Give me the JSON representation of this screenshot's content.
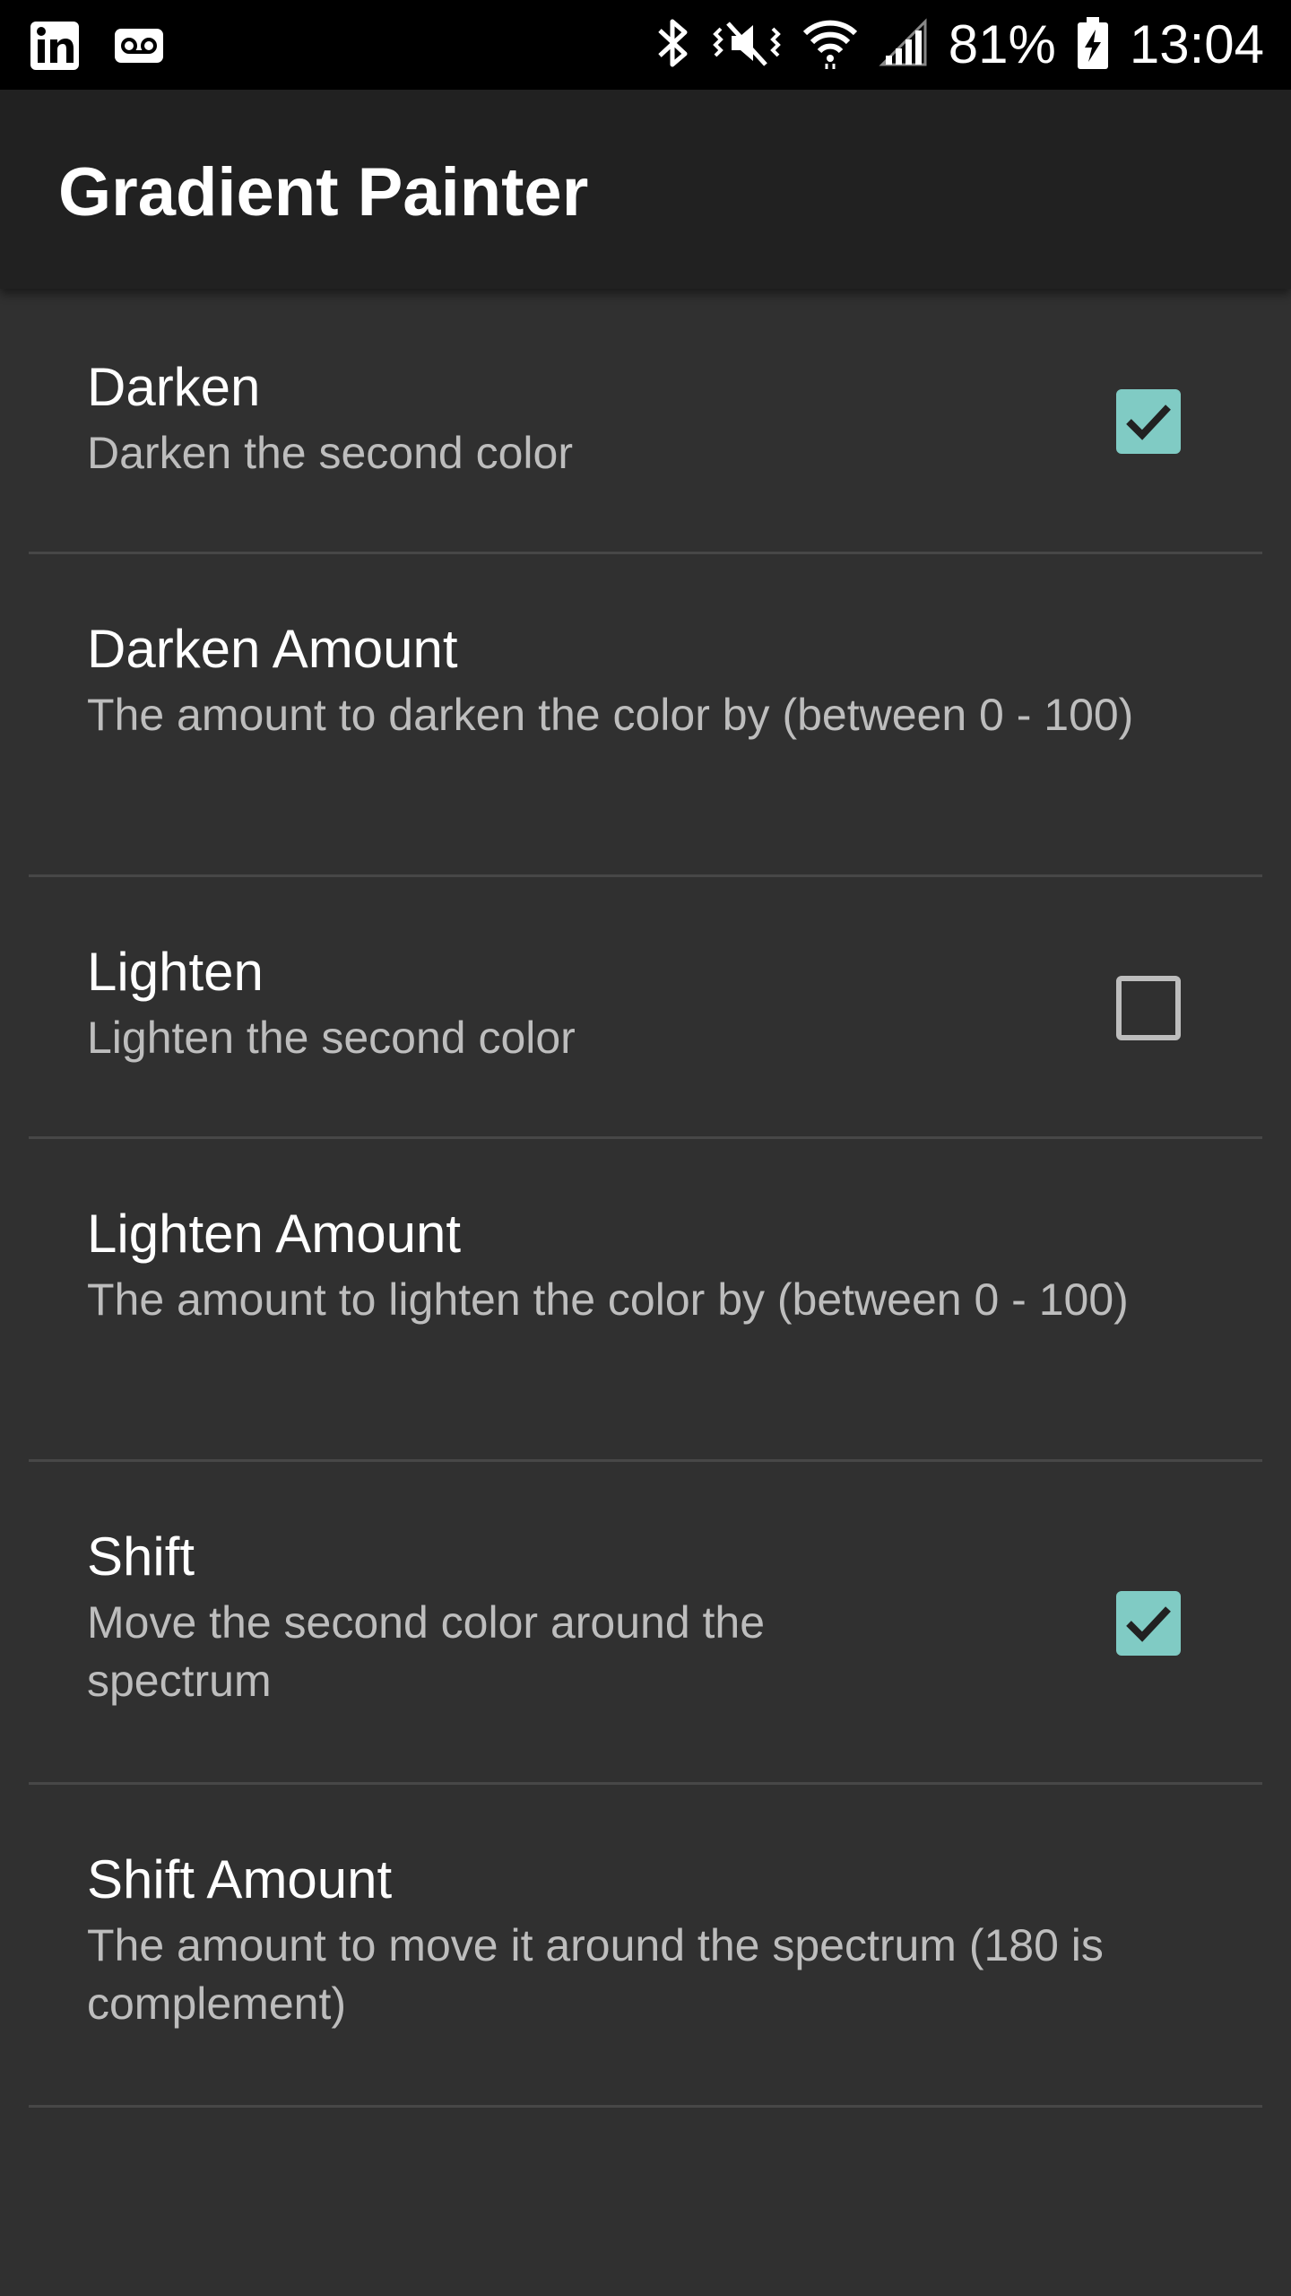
{
  "status_bar": {
    "battery_percent": "81%",
    "time": "13:04",
    "left_icons": [
      "linkedin-icon",
      "voicemail-icon"
    ],
    "right_icons": [
      "bluetooth-icon",
      "vibrate-icon",
      "wifi-icon",
      "signal-icon",
      "battery-charging-icon"
    ]
  },
  "app_bar": {
    "title": "Gradient Painter"
  },
  "colors": {
    "accent": "#80cbc4",
    "background": "#303030",
    "app_bar": "#212121",
    "status_bar": "#000000"
  },
  "preferences": [
    {
      "title": "Darken",
      "summary": "Darken the second color",
      "has_checkbox": true,
      "checked": true
    },
    {
      "title": "Darken Amount",
      "summary": "The amount to darken the color by (between 0 - 100)",
      "has_checkbox": false
    },
    {
      "title": "Lighten",
      "summary": "Lighten the second color",
      "has_checkbox": true,
      "checked": false
    },
    {
      "title": "Lighten Amount",
      "summary": "The amount to lighten the color by (between 0 - 100)",
      "has_checkbox": false
    },
    {
      "title": "Shift",
      "summary": "Move the second color around the spectrum",
      "has_checkbox": true,
      "checked": true
    },
    {
      "title": "Shift Amount",
      "summary": "The amount to move it around the spectrum (180 is complement)",
      "has_checkbox": false
    }
  ]
}
